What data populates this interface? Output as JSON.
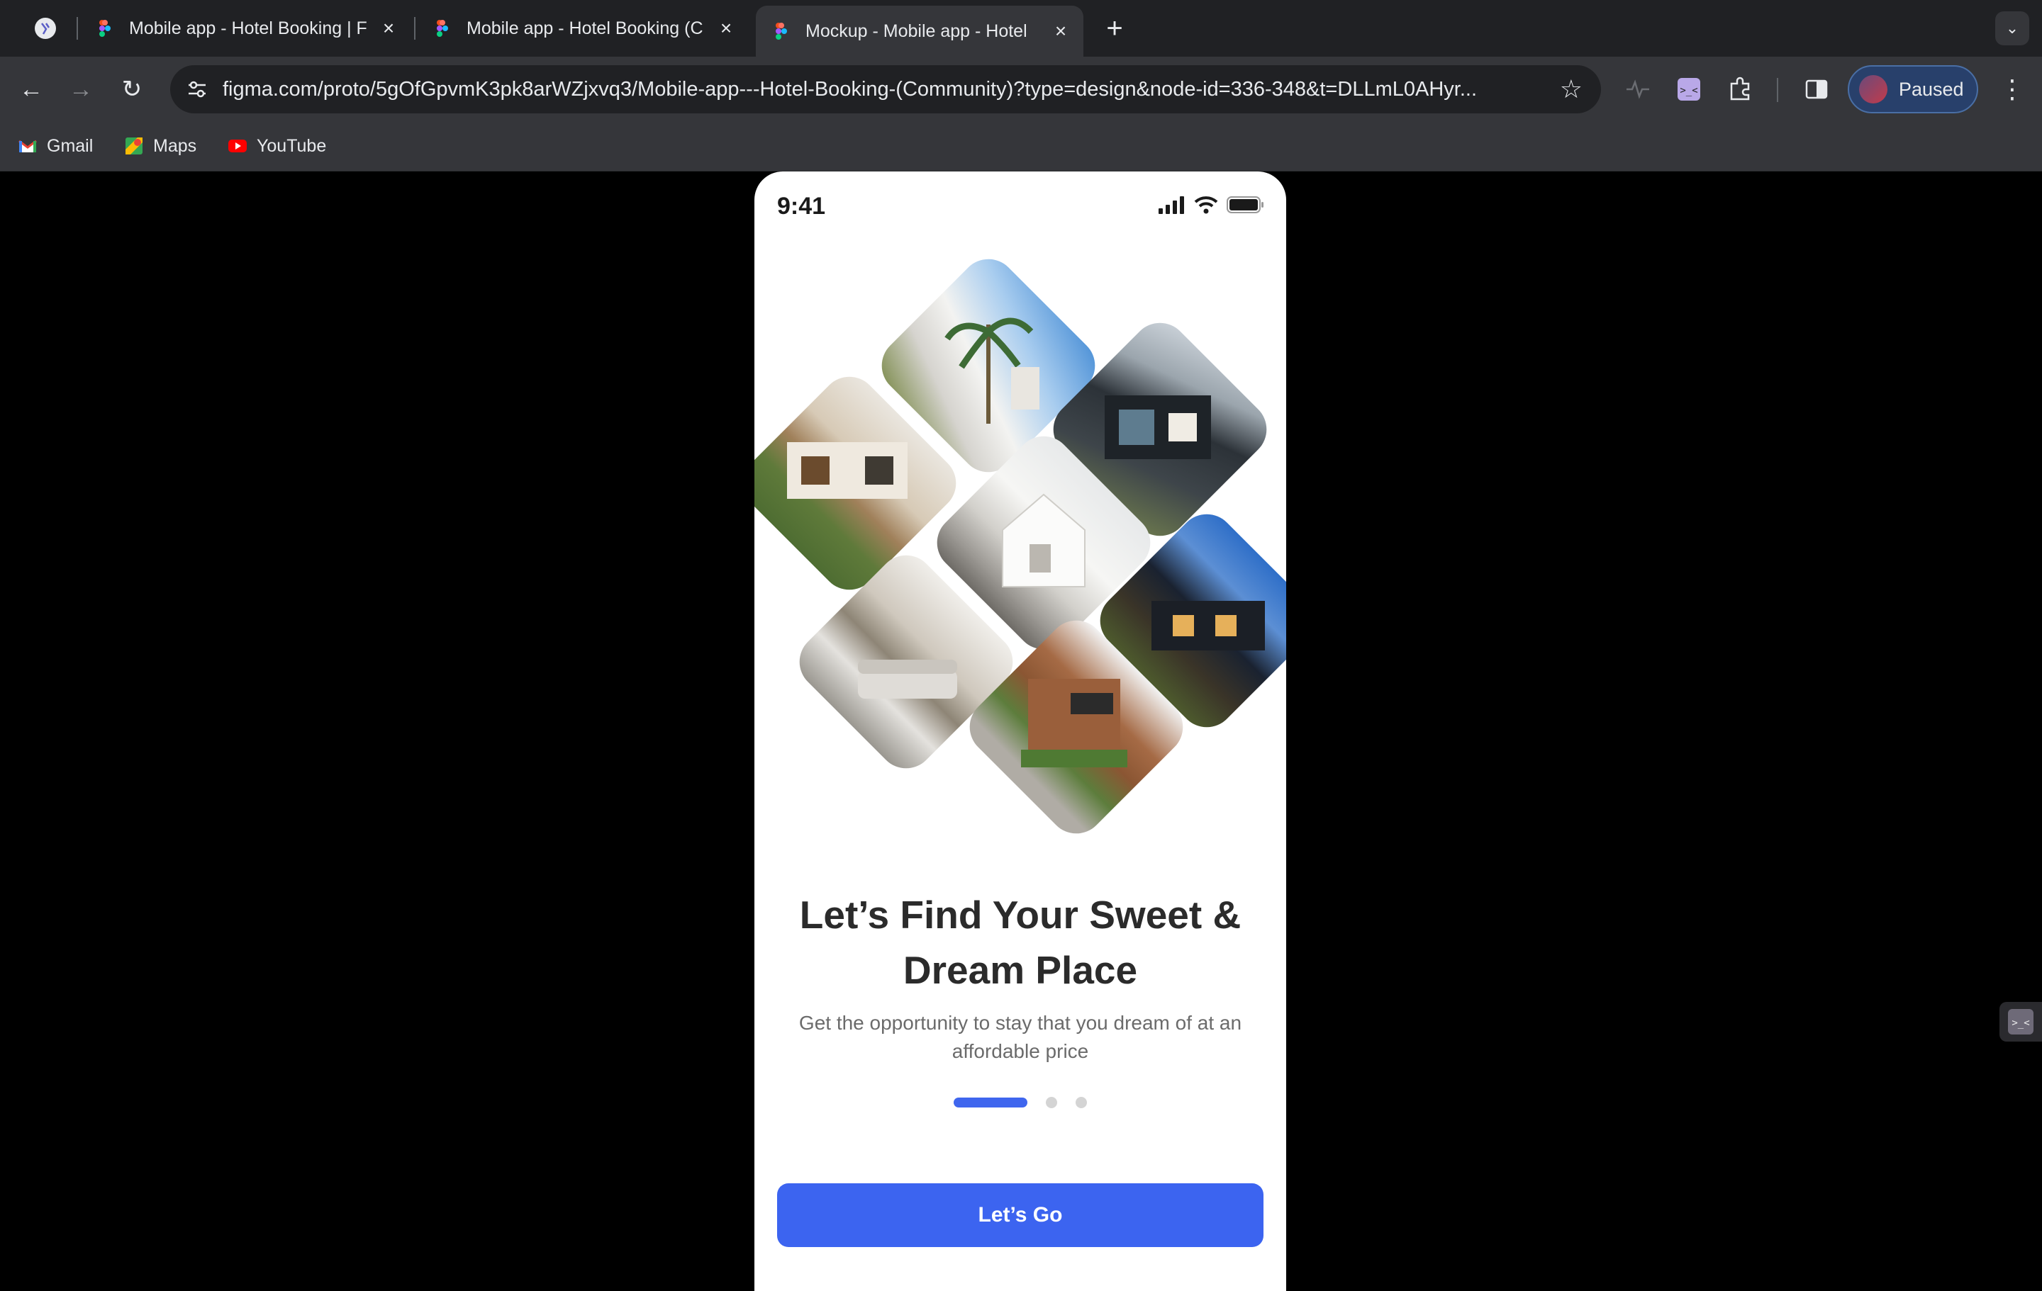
{
  "browser": {
    "tabs": [
      {
        "title": "Mobile app - Hotel Booking | F"
      },
      {
        "title": "Mobile app - Hotel Booking (C"
      },
      {
        "title": "Mockup - Mobile app - Hotel"
      }
    ],
    "new_tab": "+",
    "url": "figma.com/proto/5gOfGpvmK3pk8arWZjxvq3/Mobile-app---Hotel-Booking-(Community)?type=design&node-id=336-348&t=DLLmL0AHyr...",
    "profile_label": "Paused",
    "bookmarks": [
      {
        "label": "Gmail"
      },
      {
        "label": "Maps"
      },
      {
        "label": "YouTube"
      }
    ]
  },
  "phone": {
    "status_time": "9:41",
    "headline": "Let’s Find Your Sweet & Dream Place",
    "subtitle": "Get the opportunity to stay that you dream of at an affordable price",
    "pagination": {
      "current": 1,
      "total": 3
    },
    "cta_label": "Let’s Go",
    "accent": "#3c64f0"
  }
}
